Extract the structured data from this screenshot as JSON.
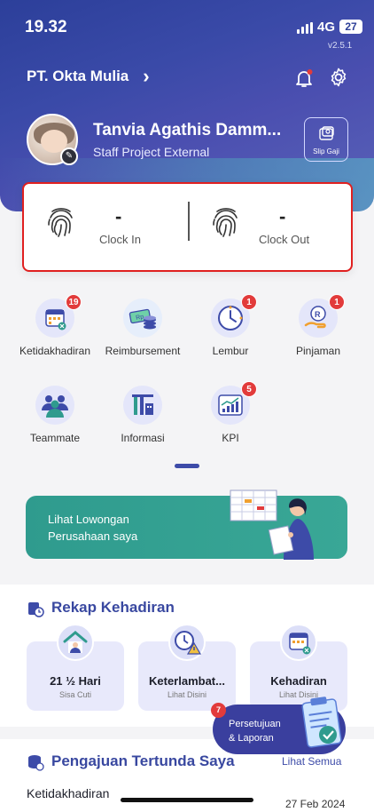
{
  "status_bar": {
    "time": "19.32",
    "network": "4G",
    "battery": "27",
    "version": "v2.5.1"
  },
  "header": {
    "company": "PT. Okta Mulia",
    "company_chevron": "›"
  },
  "user": {
    "name": "Tanvia Agathis Damm...",
    "role": "Staff Project External",
    "slip_label": "Slip Gaji"
  },
  "attendance": {
    "clock_in": {
      "value": "-",
      "label": "Clock In"
    },
    "clock_out": {
      "value": "-",
      "label": "Clock Out"
    }
  },
  "menu": [
    {
      "label": "Ketidakhadiran",
      "badge": "19",
      "icon": "calendar-icon",
      "color": "#e4e6fa"
    },
    {
      "label": "Reimbursement",
      "badge": "",
      "icon": "money-icon",
      "color": "#e6eefb"
    },
    {
      "label": "Lembur",
      "badge": "1",
      "icon": "clock-icon",
      "color": "#e4e6fa"
    },
    {
      "label": "Pinjaman",
      "badge": "1",
      "icon": "loan-icon",
      "color": "#e4e6fa"
    },
    {
      "label": "Teammate",
      "badge": "",
      "icon": "team-icon",
      "color": "#e4e6fa"
    },
    {
      "label": "Informasi",
      "badge": "",
      "icon": "building-icon",
      "color": "#e4e6fa"
    },
    {
      "label": "KPI",
      "badge": "5",
      "icon": "chart-icon",
      "color": "#e4e6fa"
    }
  ],
  "banner": {
    "line1": "Lihat Lowongan",
    "line2": "Perusahaan saya"
  },
  "rekap": {
    "title": "Rekap Kehadiran",
    "cards": [
      {
        "value": "21 ½ Hari",
        "sub": "Sisa Cuti",
        "icon": "house-icon"
      },
      {
        "value": "Keterlambat...",
        "sub": "Lihat Disini",
        "icon": "late-clock-icon"
      },
      {
        "value": "Kehadiran",
        "sub": "Lihat Disini",
        "icon": "attendance-calendar-icon"
      }
    ]
  },
  "fab": {
    "line1": "Persetujuan",
    "line2": "& Laporan",
    "badge": "7"
  },
  "pending": {
    "title": "Pengajuan Tertunda Saya",
    "see_all": "Lihat Semua",
    "first_item": "Ketidakhadiran",
    "first_date": "27 Feb 2024"
  },
  "colors": {
    "primary": "#3d4ba8",
    "accent_red": "#e23b3b",
    "banner_teal": "#2f9b8e"
  }
}
